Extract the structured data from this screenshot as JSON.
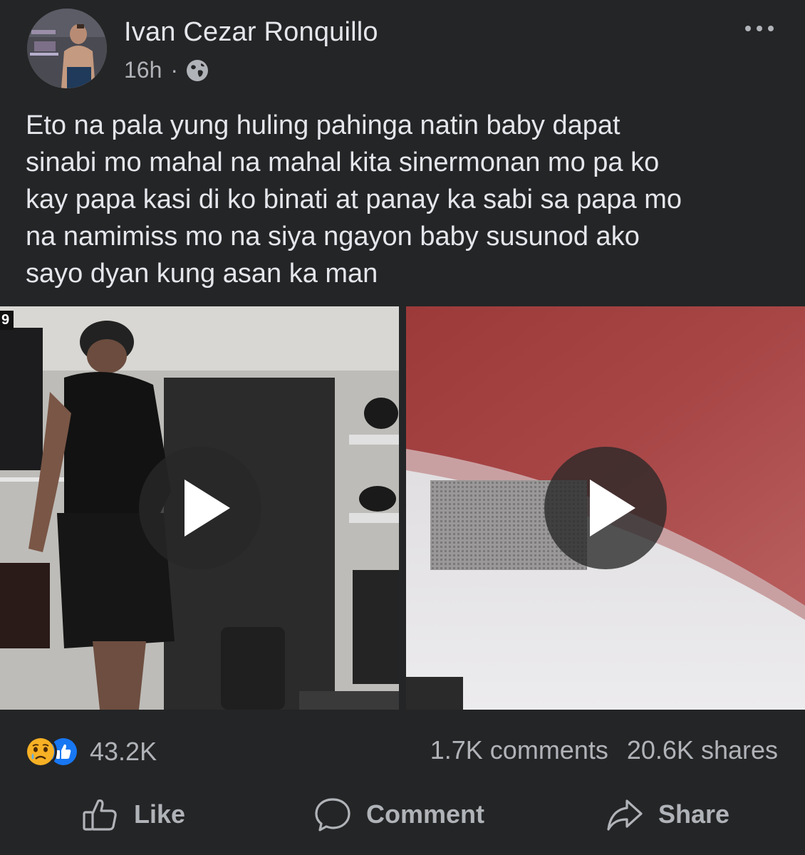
{
  "post": {
    "author": "Ivan Cezar Ronquillo",
    "time": "16h",
    "separator": "·",
    "privacy_icon": "globe-icon",
    "more_icon": "more-options-icon",
    "text": "Eto na pala yung huling pahinga natin baby dapat\nsinabi mo mahal na mahal kita sinermonan mo pa ko\nkay papa kasi di ko binati at panay ka sabi sa papa mo\nna namimiss mo na siya ngayon baby susunod ako\nsayo dyan kung asan ka man"
  },
  "media": {
    "left_video_badge": "9",
    "play_icon": "play-icon"
  },
  "stats": {
    "reaction_icons": [
      "sad-reaction-icon",
      "like-reaction-icon"
    ],
    "reaction_count": "43.2K",
    "comments": "1.7K comments",
    "shares": "20.6K shares"
  },
  "actions": {
    "like_label": "Like",
    "comment_label": "Comment",
    "share_label": "Share"
  },
  "colors": {
    "background": "#242526",
    "primary_text": "#e4e6eb",
    "secondary_text": "#b0b3b8",
    "like_blue": "#1877f2",
    "sad_yellow": "#f7b125"
  }
}
